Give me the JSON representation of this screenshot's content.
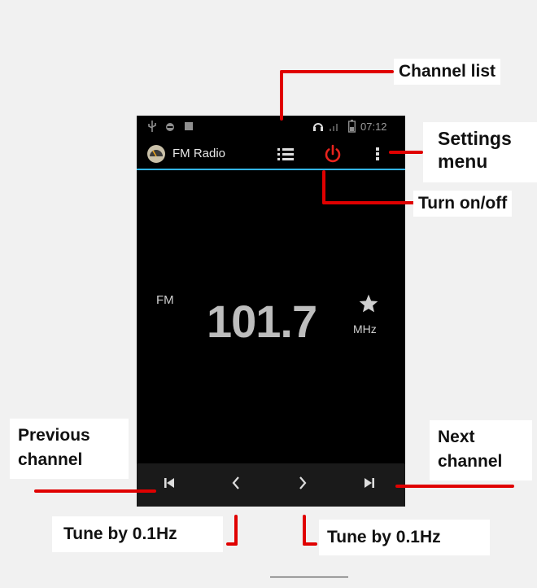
{
  "status_bar": {
    "time": "07:12",
    "icons": [
      "usb-icon",
      "voicemail-icon",
      "notification-icon",
      "headset-icon",
      "signal-icon",
      "battery-icon"
    ]
  },
  "action_bar": {
    "app_icon": "radio-app-icon",
    "title": "FM Radio",
    "actions": [
      "channel-list-icon",
      "power-icon",
      "overflow-menu-icon"
    ],
    "power_color": "#e8231d",
    "divider_color": "#33b5e5"
  },
  "tuner": {
    "band": "FM",
    "frequency": "101.7",
    "unit": "MHz",
    "favorite_icon": "star-icon"
  },
  "controls": {
    "icons": [
      "prev-channel-icon",
      "tune-down-icon",
      "tune-up-icon",
      "next-channel-icon"
    ]
  },
  "callouts": {
    "channel_list": "Channel list",
    "settings_menu_line1": "Settings",
    "settings_menu_line2": "menu",
    "turn_on_off": "Turn on/off",
    "previous_channel_line1": "Previous",
    "previous_channel_line2": "channel",
    "next_channel_line1": "Next",
    "next_channel_line2": "channel",
    "tune_left": "Tune by 0.1Hz",
    "tune_right": "Tune by 0.1Hz",
    "line_color": "#e00000"
  }
}
